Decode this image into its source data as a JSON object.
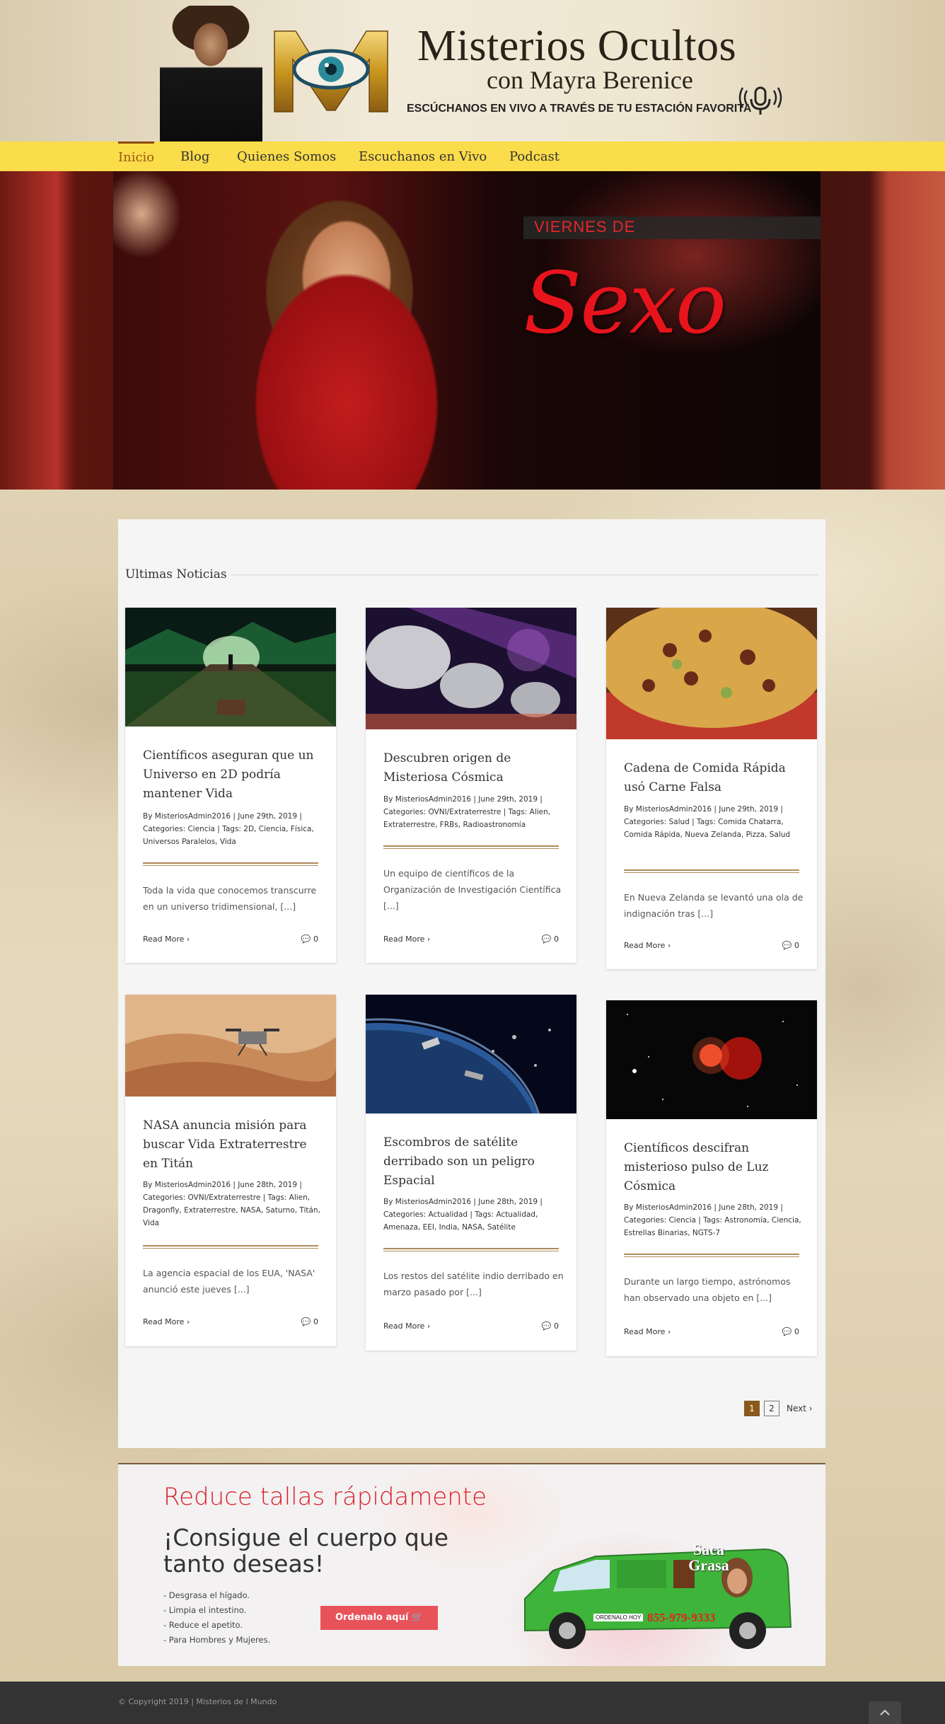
{
  "header": {
    "title": "Misterios Ocultos",
    "subtitle": "con Mayra Berenice",
    "tagline": "ESCÚCHANOS EN VIVO A TRAVÉS DE TU ESTACIÓN FAVORITA"
  },
  "nav": {
    "items": [
      "Inicio",
      "Blog",
      "Quienes Somos",
      "Escuchanos en Vivo",
      "Podcast"
    ],
    "active": "Inicio"
  },
  "hero": {
    "small_text": "VIERNES DE",
    "big_text": "Sexo"
  },
  "section": {
    "title": "Ultimas Noticias"
  },
  "posts": [
    {
      "title": "Científicos aseguran que un Universo en 2D podría mantener Vida",
      "meta": "By MisteriosAdmin2016 | June 29th, 2019 | Categories: Ciencia | Tags: 2D, Ciencia, Física, Universos Paralelos, Vida",
      "excerpt": "Toda la vida que conocemos transcurre en un universo tridimensional, [...]",
      "more": "Read More",
      "comments": "0"
    },
    {
      "title": "Descubren origen de Misteriosa Cósmica",
      "meta": "By MisteriosAdmin2016 | June 29th, 2019 | Categories: OVNI/Extraterrestre | Tags: Alien, Extraterrestre, FRBs, Radioastronomía",
      "excerpt": "Un equipo de científicos de la Organización de Investigación Científica [...]",
      "more": "Read More",
      "comments": "0"
    },
    {
      "title": "Cadena de Comida Rápida usó Carne Falsa",
      "meta": "By MisteriosAdmin2016 | June 29th, 2019 | Categories: Salud | Tags: Comida Chatarra, Comida Rápida, Nueva Zelanda, Pizza, Salud",
      "excerpt": "En Nueva Zelanda se levantó una ola de indignación tras [...]",
      "more": "Read More",
      "comments": "0"
    },
    {
      "title": "NASA anuncia misión para buscar Vida Extraterrestre en Titán",
      "meta": "By MisteriosAdmin2016 | June 28th, 2019 | Categories: OVNI/Extraterrestre | Tags: Alien, Dragonfly, Extraterrestre, NASA, Saturno, Titán, Vida",
      "excerpt": "La agencia espacial de los EUA, 'NASA' anunció este jueves [...]",
      "more": "Read More",
      "comments": "0"
    },
    {
      "title": "Escombros de satélite derribado son un peligro Espacial",
      "meta": "By MisteriosAdmin2016 | June 28th, 2019 | Categories: Actualidad | Tags: Actualidad, Amenaza, EEI, India, NASA, Satélite",
      "excerpt": "Los restos del satélite indio derribado en marzo pasado por [...]",
      "more": "Read More",
      "comments": "0"
    },
    {
      "title": "Científicos descifran misterioso pulso de Luz Cósmica",
      "meta": "By MisteriosAdmin2016 | June 28th, 2019 | Categories: Ciencia | Tags: Astronomía, Ciencia, Estrellas Binarias, NGTS-7",
      "excerpt": "Durante un largo tiempo, astrónomos han observado una objeto en [...]",
      "more": "Read More",
      "comments": "0"
    }
  ],
  "pagination": {
    "pages": [
      "1",
      "2"
    ],
    "current": "1",
    "next": "Next"
  },
  "ad": {
    "headline": "Reduce tallas rápidamente",
    "subheadline": "¡Consigue el cuerpo que tanto deseas!",
    "bullets": [
      "- Desgrasa el hígado.",
      "- Limpia el intestino.",
      "- Reduce el apetito.",
      "- Para Hombres y Mujeres."
    ],
    "button": "Ordenalo aquí",
    "van_brand": "Saca Grasa",
    "van_phone": "855-979-9333",
    "van_order": "ORDENALO HOY"
  },
  "footer": {
    "copyright": "© Copyright 2019 | Misterios de l Mundo"
  },
  "colors": {
    "nav_bg": "#fbdc4a",
    "active_nav": "#9a5a1a",
    "ad_headline": "#d8202a",
    "ad_button": "#e8535a",
    "footer_bg": "#333333"
  }
}
